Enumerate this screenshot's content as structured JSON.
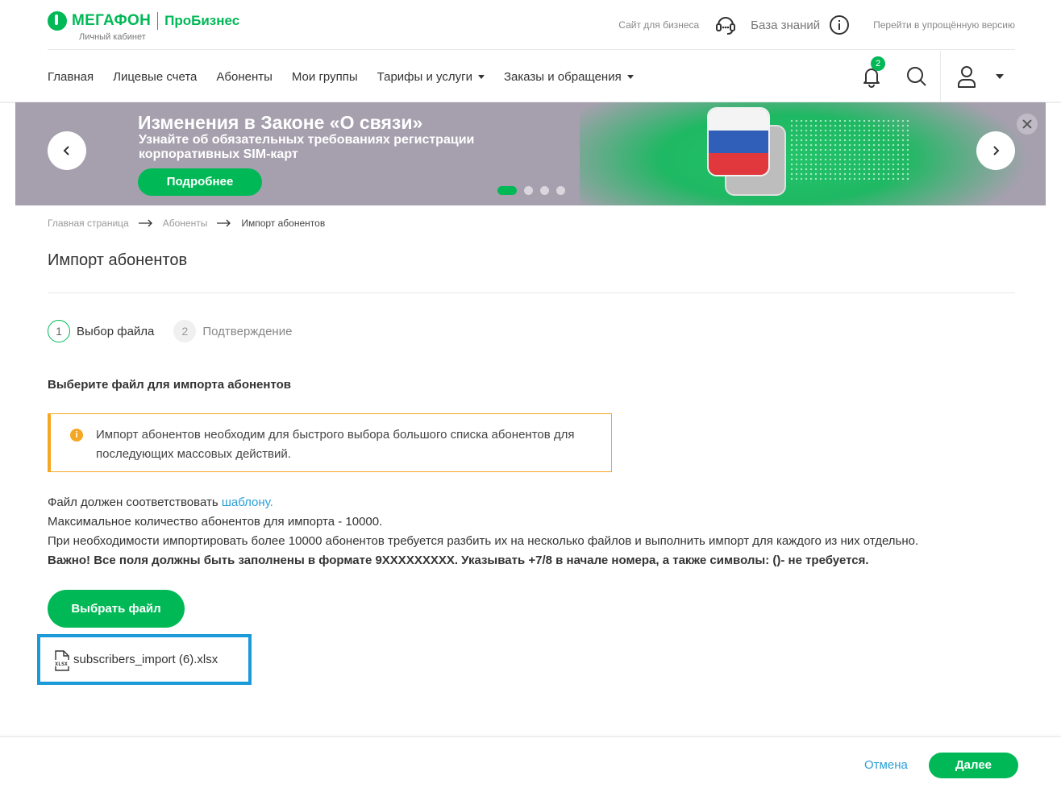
{
  "header": {
    "brand": "МЕГАФОН",
    "brand_sub": "ПроБизнес",
    "caption": "Личный кабинет",
    "links": {
      "business_site": "Сайт для бизнеса",
      "knowledge_base": "База знаний",
      "simple_version": "Перейти в упрощённую версию"
    }
  },
  "nav": {
    "items": [
      {
        "label": "Главная"
      },
      {
        "label": "Лицевые счета"
      },
      {
        "label": "Абоненты"
      },
      {
        "label": "Мои группы"
      },
      {
        "label": "Тарифы и услуги"
      },
      {
        "label": "Заказы и обращения"
      }
    ],
    "notifications_count": "2"
  },
  "banner": {
    "title": "Изменения в Законе «О связи»",
    "subtitle": "Узнайте об обязательных требованиях регистрации корпоративных SIM-карт",
    "button": "Подробнее",
    "slide_count": 4,
    "active_slide": 1
  },
  "breadcrumb": {
    "items": [
      "Главная страница",
      "Абоненты",
      "Импорт абонентов"
    ]
  },
  "page": {
    "title": "Импорт абонентов",
    "steps": [
      {
        "number": "1",
        "label": "Выбор файла"
      },
      {
        "number": "2",
        "label": "Подтверждение"
      }
    ],
    "section_heading": "Выберите файл для импорта абонентов",
    "notice": "Импорт абонентов необходим для быстрого выбора большого списка абонентов для последующих массовых действий.",
    "info": {
      "line1_prefix": "Файл должен соответствовать ",
      "line1_link": "шаблону.",
      "line2": "Максимальное количество абонентов для импорта - 10000.",
      "line3": "При необходимости импортировать более 10000 абонентов требуется разбить их на несколько файлов и выполнить импорт для каждого из них отдельно.",
      "line4": "Важно! Все поля должны быть заполнены в формате 9XXXXXXXXX. Указывать +7/8 в начале номера, а также символы: ()- не требуется."
    },
    "choose_file_button": "Выбрать файл",
    "file": {
      "name": "subscribers_import (6).xlsx",
      "icon_label": "XLSX"
    }
  },
  "footer": {
    "cancel": "Отмена",
    "next": "Далее"
  },
  "colors": {
    "brand_green": "#00b956",
    "link_blue": "#2a9fd8",
    "warning_orange": "#f5a623",
    "highlight_blue": "#1a9ad8"
  }
}
